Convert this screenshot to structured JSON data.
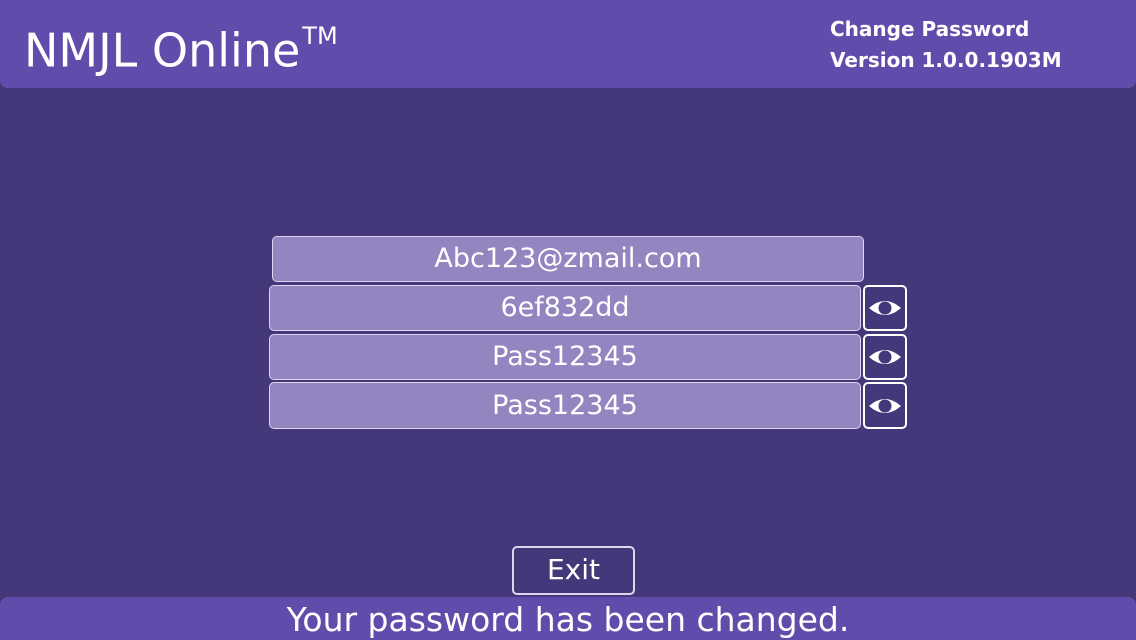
{
  "header": {
    "title": "NMJL Online",
    "trademark": "TM",
    "screen_name": "Change Password",
    "version": "Version 1.0.0.1903M"
  },
  "form": {
    "email": "Abc123@zmail.com",
    "current_password": "6ef832dd",
    "new_password": "Pass12345",
    "confirm_password": "Pass12345"
  },
  "icons": {
    "toggle_visibility": "eye-icon"
  },
  "actions": {
    "exit_label": "Exit"
  },
  "footer": {
    "status_message": "Your password has been changed."
  },
  "colors": {
    "background": "#45387a",
    "bar": "#624cab",
    "field": "#9285c0"
  }
}
